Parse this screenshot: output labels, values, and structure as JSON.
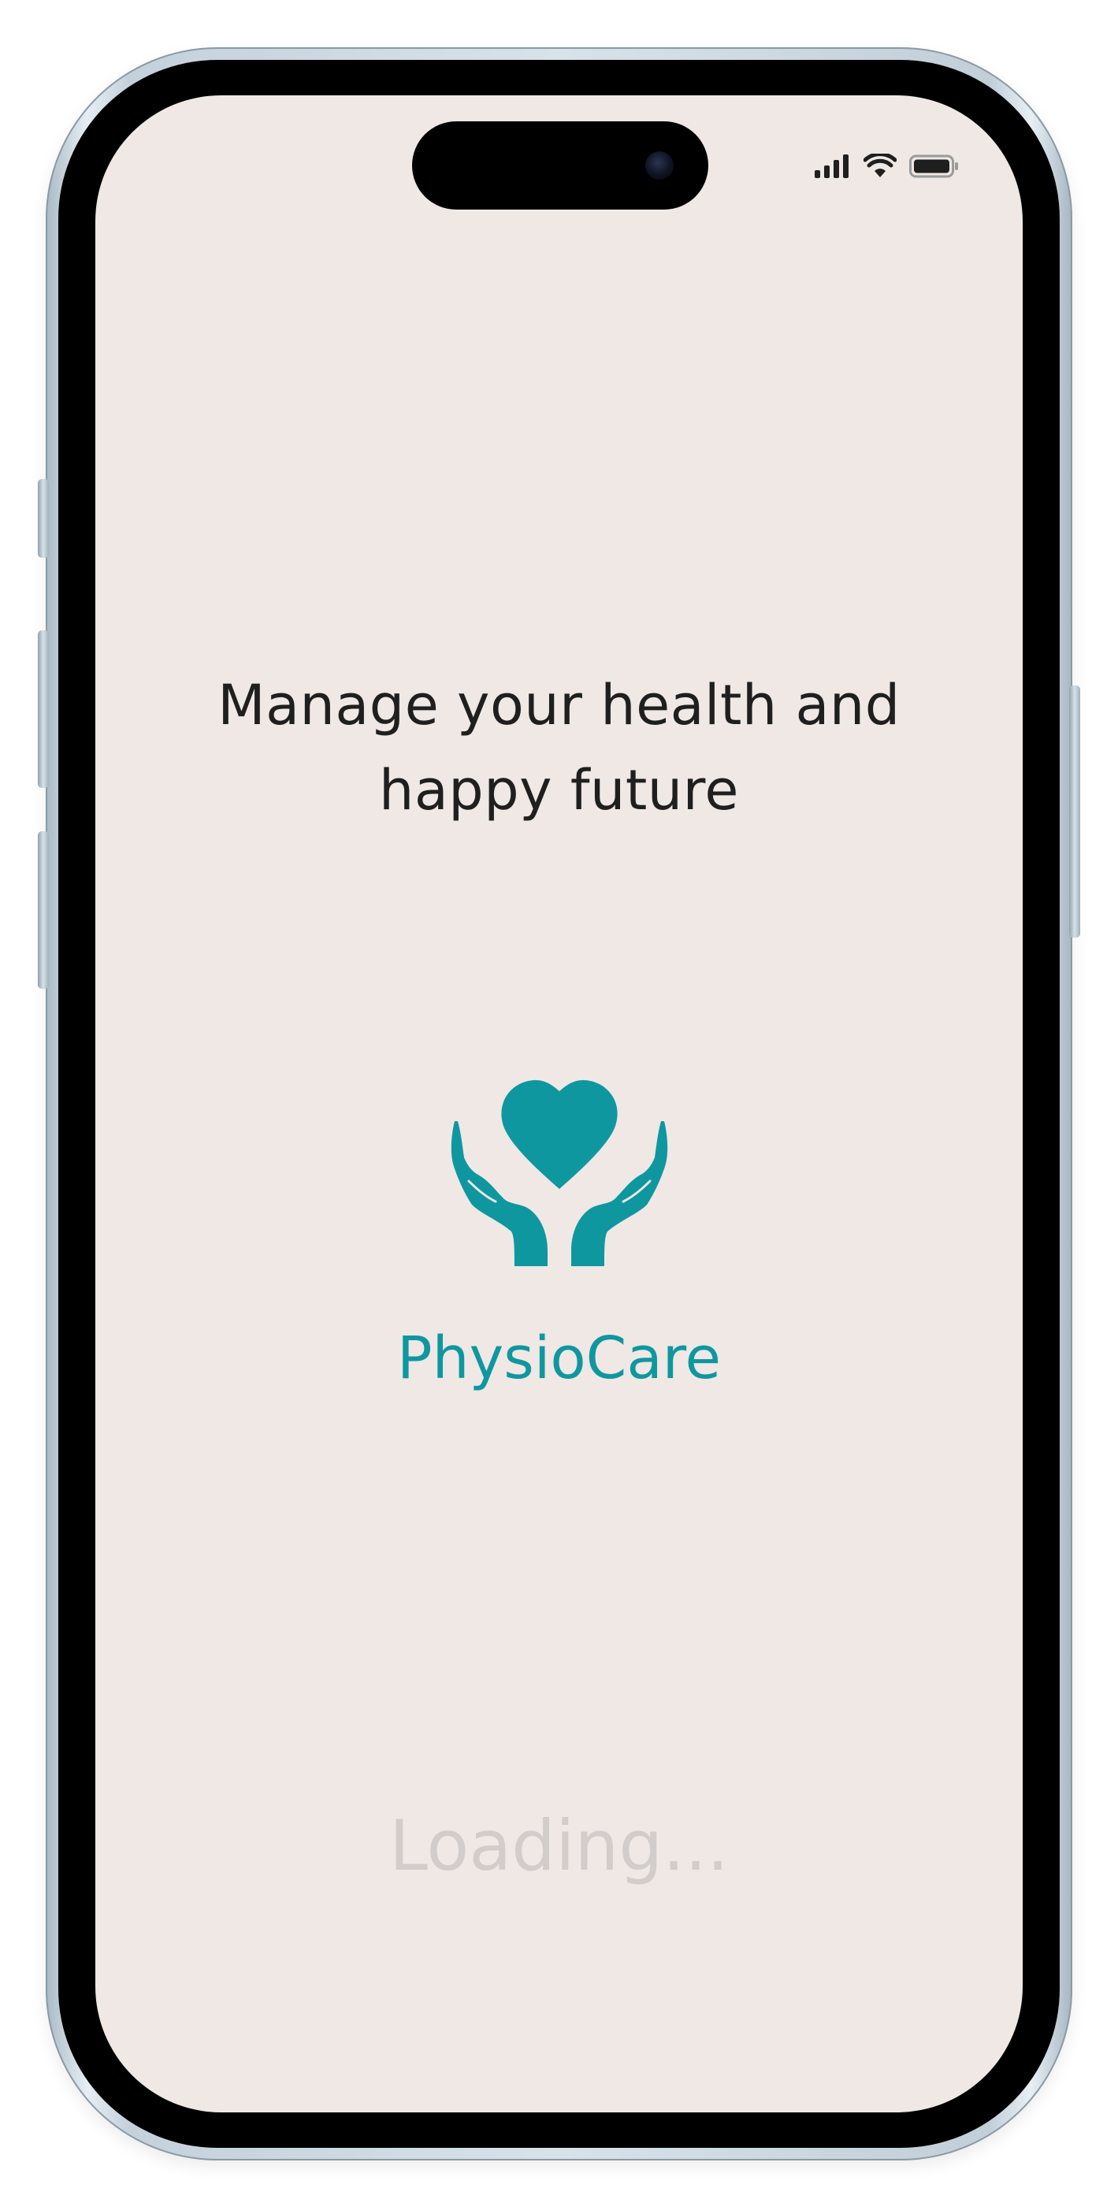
{
  "status_bar": {
    "signal_icon": "cellular-signal-icon",
    "wifi_icon": "wifi-icon",
    "battery_icon": "battery-icon"
  },
  "splash": {
    "headline_line1": "Manage your health and",
    "headline_line2": "happy future",
    "logo_icon": "hands-holding-heart-icon",
    "brand_name": "PhysioCare",
    "loading_text": "Loading..."
  },
  "colors": {
    "background": "#efe8e5",
    "brand": "#0f97a0",
    "headline": "#1f1f1f",
    "loading": "#d2cdcb"
  }
}
